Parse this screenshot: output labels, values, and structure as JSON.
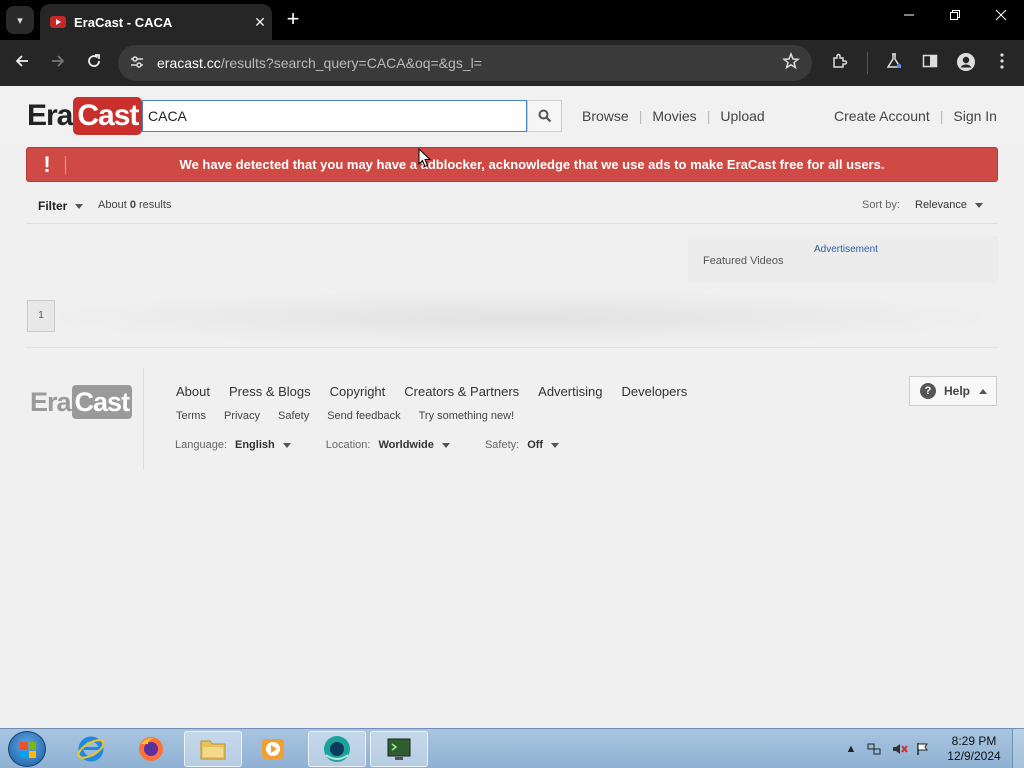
{
  "browser": {
    "tab_title": "EraCast - CACA",
    "tab_close": "✕",
    "new_tab": "+",
    "url_host": "eracast.cc",
    "url_path": "/results?search_query=CACA&oq=&gs_l="
  },
  "header": {
    "logo_era": "Era",
    "logo_cast": "Cast",
    "search_value": "CACA",
    "nav": [
      "Browse",
      "Movies",
      "Upload"
    ],
    "account": [
      "Create Account",
      "Sign In"
    ]
  },
  "banner": {
    "icon": "!",
    "message": "We have detected that you may have a adblocker, acknowledge that we use ads to make EraCast free for all users."
  },
  "filter": {
    "label": "Filter",
    "results_prefix": "About ",
    "results_count": "0",
    "results_suffix": " results",
    "sortby_label": "Sort by:",
    "sortby_value": "Relevance"
  },
  "content": {
    "featured_label": "Featured Videos",
    "advertisement_label": "Advertisement",
    "page_number": "1"
  },
  "footer": {
    "primary_links": [
      "About",
      "Press & Blogs",
      "Copyright",
      "Creators & Partners",
      "Advertising",
      "Developers"
    ],
    "secondary_links": [
      "Terms",
      "Privacy",
      "Safety",
      "Send feedback",
      "Try something new!"
    ],
    "language_label": "Language:",
    "language_value": "English",
    "location_label": "Location:",
    "location_value": "Worldwide",
    "safety_label": "Safety:",
    "safety_value": "Off",
    "help_label": "Help",
    "help_icon": "?"
  },
  "taskbar": {
    "time": "8:29 PM",
    "date": "12/9/2024"
  },
  "colors": {
    "brand_red": "#c9302c",
    "banner_red": "#cf4a44",
    "link_blue": "#2b5fa8",
    "chrome_dark": "#262626"
  },
  "icons": {
    "tab_list": "chevron-down-icon",
    "back": "arrow-left-icon",
    "forward": "arrow-right-icon",
    "reload": "reload-icon",
    "site_info": "tune-icon",
    "bookmark": "star-icon",
    "extensions": "puzzle-icon",
    "labs": "flask-icon",
    "sidepanel": "side-panel-icon",
    "profile": "profile-icon",
    "menu": "kebab-menu-icon",
    "search": "search-icon"
  }
}
